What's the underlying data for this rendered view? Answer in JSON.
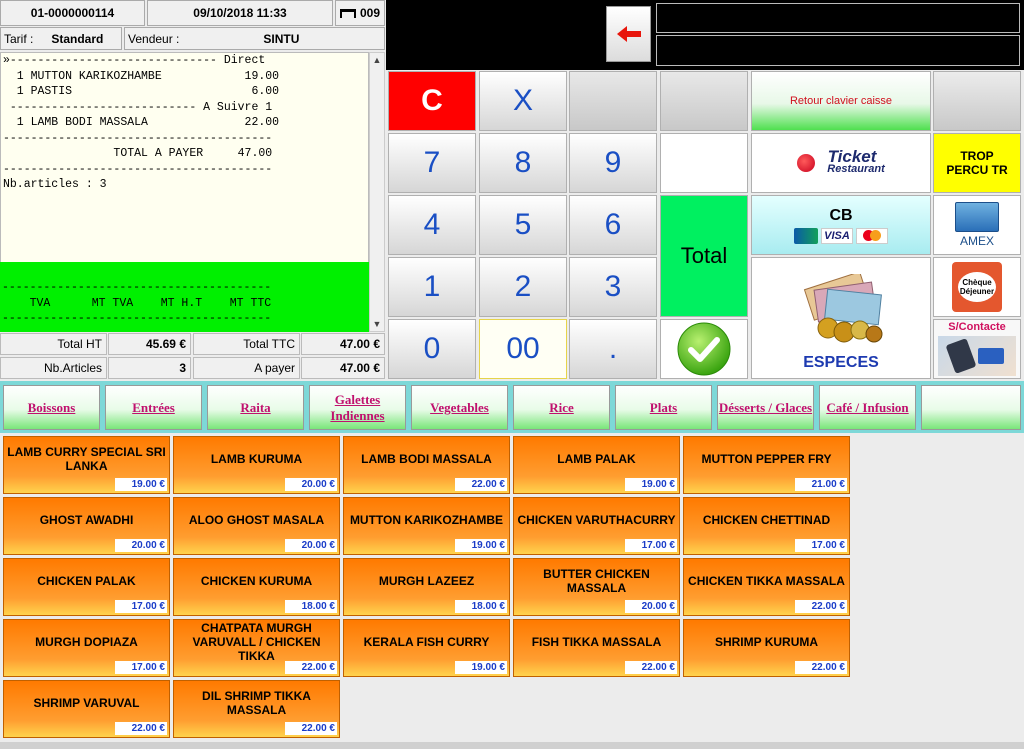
{
  "header": {
    "order_number": "01-0000000114",
    "datetime": "09/10/2018 11:33",
    "table_number": "009",
    "tarif_label": "Tarif :",
    "tarif_value": "Standard",
    "vendeur_label": "Vendeur :",
    "vendeur_value": "SINTU"
  },
  "ticket": {
    "lines": [
      "»------------------------------ Direct",
      "  1 MUTTON KARIKOZHAMBE            19.00",
      "  1 PASTIS                          6.00",
      " --------------------------- A Suivre 1",
      "  1 LAMB BODI MASSALA              22.00",
      "---------------------------------------",
      "                TOTAL A PAYER     47.00",
      "---------------------------------------",
      "Nb.articles : 3"
    ],
    "vat_lines": [
      "---------------------------------------",
      "    TVA      MT TVA    MT H.T    MT TTC",
      "---------------------------------------"
    ]
  },
  "totals": {
    "total_ht_label": "Total HT",
    "total_ht_value": "45.69 €",
    "total_ttc_label": "Total TTC",
    "total_ttc_value": "47.00 €",
    "nb_articles_label": "Nb.Articles",
    "nb_articles_value": "3",
    "a_payer_label": "A payer",
    "a_payer_value": "47.00 €"
  },
  "keypad": {
    "clear": "C",
    "multiply": "X",
    "k7": "7",
    "k8": "8",
    "k9": "9",
    "k4": "4",
    "k5": "5",
    "k6": "6",
    "k1": "1",
    "k2": "2",
    "k3": "3",
    "k0": "0",
    "k00": "00",
    "dot": ".",
    "total": "Total"
  },
  "payment": {
    "retour": "Retour clavier caisse",
    "ticket_restaurant_1": "Ticket",
    "ticket_restaurant_2": "Restaurant",
    "trop_percu": "TROP PERCU TR",
    "cb": "CB",
    "cb_visa": "VISA",
    "amex": "AMEX",
    "cheque_dejeuner_1": "Chèque",
    "cheque_dejeuner_2": "Déjeuner",
    "especes": "ESPECES",
    "sans_contact": "S/Contacte"
  },
  "categories": [
    "Boissons",
    "Entrées",
    "Raita",
    "Galettes Indiennes",
    "Vegetables",
    "Rice",
    "Plats",
    "Désserts / Glaces",
    "Café / Infusion",
    ""
  ],
  "products": [
    {
      "name": "LAMB CURRY SPECIAL SRI LANKA",
      "price": "19.00 €"
    },
    {
      "name": "LAMB KURUMA",
      "price": "20.00 €"
    },
    {
      "name": "LAMB BODI MASSALA",
      "price": "22.00 €"
    },
    {
      "name": "LAMB PALAK",
      "price": "19.00 €"
    },
    {
      "name": "MUTTON PEPPER FRY",
      "price": "21.00 €"
    },
    {
      "name": "GHOST AWADHI",
      "price": "20.00 €"
    },
    {
      "name": "ALOO GHOST MASALA",
      "price": "20.00 €"
    },
    {
      "name": "MUTTON KARIKOZHAMBE",
      "price": "19.00 €"
    },
    {
      "name": "CHICKEN VARUTHACURRY",
      "price": "17.00 €"
    },
    {
      "name": "CHICKEN CHETTINAD",
      "price": "17.00 €"
    },
    {
      "name": "CHICKEN PALAK",
      "price": "17.00 €"
    },
    {
      "name": "CHICKEN KURUMA",
      "price": "18.00 €"
    },
    {
      "name": "MURGH LAZEEZ",
      "price": "18.00 €"
    },
    {
      "name": "BUTTER CHICKEN MASSALA",
      "price": "20.00 €"
    },
    {
      "name": "CHICKEN TIKKA MASSALA",
      "price": "22.00 €"
    },
    {
      "name": "MURGH DOPIAZA",
      "price": "17.00 €"
    },
    {
      "name": "CHATPATA MURGH VARUVALL / CHICKEN TIKKA",
      "price": "22.00 €"
    },
    {
      "name": "KERALA FISH CURRY",
      "price": "19.00 €"
    },
    {
      "name": "FISH TIKKA MASSALA",
      "price": "22.00 €"
    },
    {
      "name": "SHRIMP KURUMA",
      "price": "22.00 €"
    },
    {
      "name": "SHRIMP VARUVAL",
      "price": "22.00 €"
    },
    {
      "name": "DIL SHRIMP TIKKA MASSALA",
      "price": "22.00 €"
    }
  ],
  "colors": {
    "accent_red": "#ff0000",
    "ticket_bg": "#fffff0",
    "green": "#00f000",
    "product_orange": "#ff8c1a",
    "category_text": "#c0106e",
    "price_blue": "#1a3cc8"
  }
}
